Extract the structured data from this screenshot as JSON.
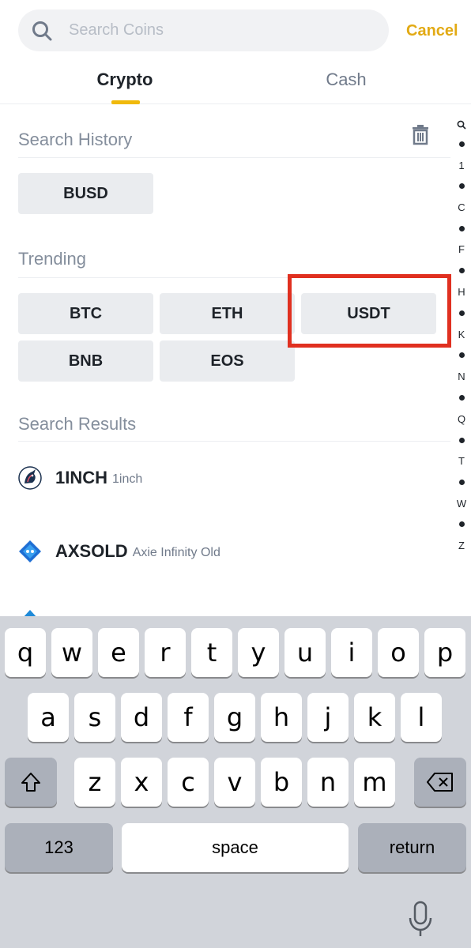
{
  "search": {
    "placeholder": "Search Coins",
    "value": ""
  },
  "cancel_label": "Cancel",
  "tabs": [
    {
      "label": "Crypto",
      "active": true
    },
    {
      "label": "Cash",
      "active": false
    }
  ],
  "history": {
    "title": "Search History",
    "chips": [
      "BUSD"
    ]
  },
  "trending": {
    "title": "Trending",
    "chips": [
      "BTC",
      "ETH",
      "USDT",
      "BNB",
      "EOS"
    ]
  },
  "results": {
    "title": "Search Results",
    "items": [
      {
        "symbol": "1INCH",
        "name": "1inch",
        "icon": "1inch-unicorn-icon"
      },
      {
        "symbol": "AXSOLD",
        "name": "Axie Infinity Old",
        "icon": "axie-diamond-icon"
      }
    ]
  },
  "alpha_index": [
    "Q",
    "1",
    "C",
    "F",
    "H",
    "K",
    "N",
    "Q",
    "T",
    "W",
    "Z"
  ],
  "keyboard": {
    "row1": [
      "q",
      "w",
      "e",
      "r",
      "t",
      "y",
      "u",
      "i",
      "o",
      "p"
    ],
    "row2": [
      "a",
      "s",
      "d",
      "f",
      "g",
      "h",
      "j",
      "k",
      "l"
    ],
    "row3": [
      "z",
      "x",
      "c",
      "v",
      "b",
      "n",
      "m"
    ],
    "numbers_label": "123",
    "space_label": "space",
    "return_label": "return"
  },
  "colors": {
    "accent": "#f0b90b",
    "cancel": "#e2aa14",
    "highlight": "#e03020",
    "chip_bg": "#eaecef"
  }
}
